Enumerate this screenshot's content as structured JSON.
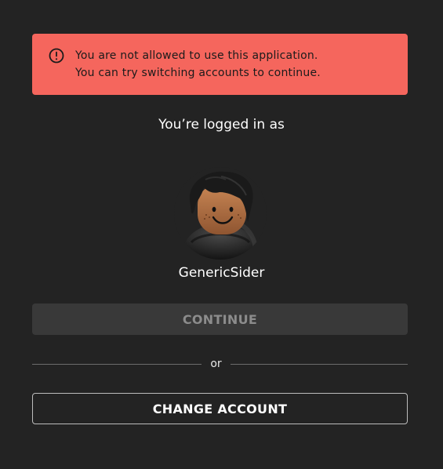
{
  "alert": {
    "icon": "error-circle-icon",
    "line1": "You are not allowed to use this application.",
    "line2": "You can try switching accounts to continue.",
    "background_color": "#f5665d"
  },
  "account": {
    "logged_in_label": "You’re logged in as",
    "username": "GenericSider",
    "avatar_icon": "roblox-avatar-headshot"
  },
  "actions": {
    "continue_label": "CONTINUE",
    "continue_disabled": true,
    "or_label": "or",
    "change_account_label": "CHANGE ACCOUNT"
  },
  "theme": {
    "background": "#232323",
    "text": "#ffffff",
    "disabled_button": "#393939",
    "disabled_text": "#8c8c8c"
  }
}
